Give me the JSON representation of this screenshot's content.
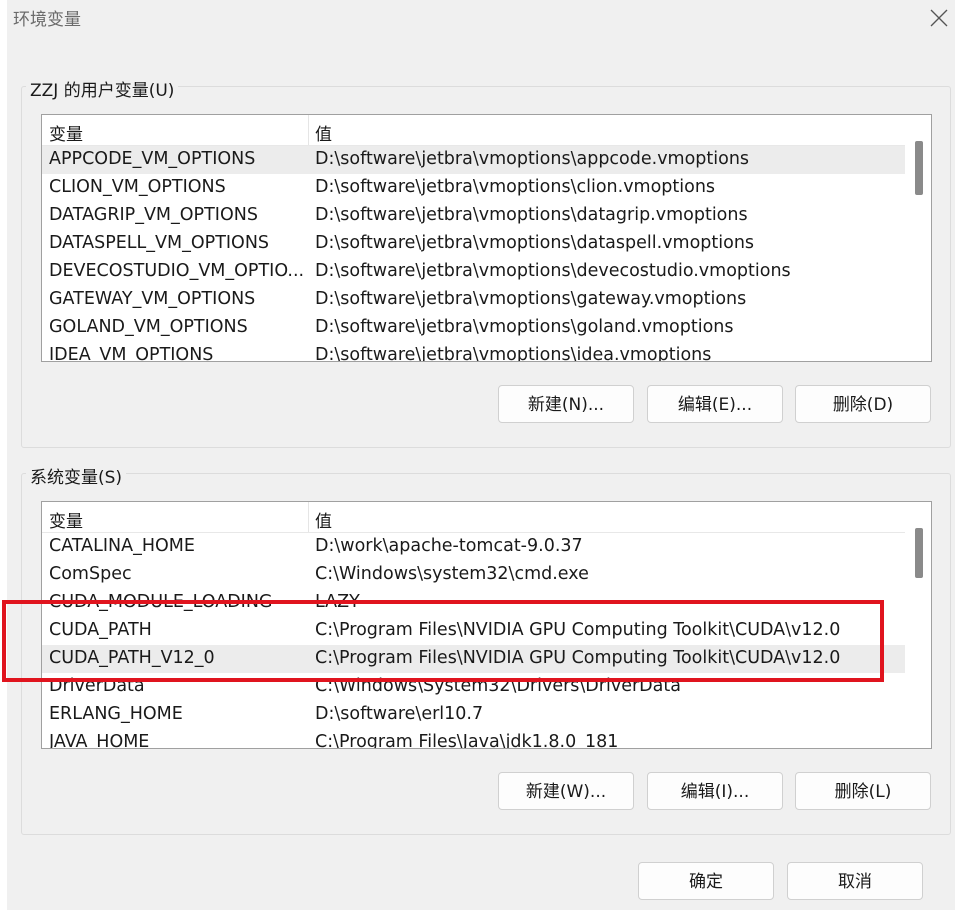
{
  "window": {
    "title": "环境变量"
  },
  "user_vars": {
    "label": "ZZJ 的用户变量(U)",
    "columns": [
      "变量",
      "值"
    ],
    "rows": [
      {
        "name": "APPCODE_VM_OPTIONS",
        "value": "D:\\software\\jetbra\\vmoptions\\appcode.vmoptions"
      },
      {
        "name": "CLION_VM_OPTIONS",
        "value": "D:\\software\\jetbra\\vmoptions\\clion.vmoptions"
      },
      {
        "name": "DATAGRIP_VM_OPTIONS",
        "value": "D:\\software\\jetbra\\vmoptions\\datagrip.vmoptions"
      },
      {
        "name": "DATASPELL_VM_OPTIONS",
        "value": "D:\\software\\jetbra\\vmoptions\\dataspell.vmoptions"
      },
      {
        "name": "DEVECOSTUDIO_VM_OPTIO...",
        "value": "D:\\software\\jetbra\\vmoptions\\devecostudio.vmoptions"
      },
      {
        "name": "GATEWAY_VM_OPTIONS",
        "value": "D:\\software\\jetbra\\vmoptions\\gateway.vmoptions"
      },
      {
        "name": "GOLAND_VM_OPTIONS",
        "value": "D:\\software\\jetbra\\vmoptions\\goland.vmoptions"
      },
      {
        "name": "IDEA_VM_OPTIONS",
        "value": "D:\\software\\jetbra\\vmoptions\\idea.vmoptions"
      }
    ],
    "buttons": {
      "new": "新建(N)...",
      "edit": "编辑(E)...",
      "delete": "删除(D)"
    }
  },
  "system_vars": {
    "label": "系统变量(S)",
    "columns": [
      "变量",
      "值"
    ],
    "rows": [
      {
        "name": "CATALINA_HOME",
        "value": "D:\\work\\apache-tomcat-9.0.37"
      },
      {
        "name": "ComSpec",
        "value": "C:\\Windows\\system32\\cmd.exe"
      },
      {
        "name": "CUDA_MODULE_LOADING",
        "value": "LAZY"
      },
      {
        "name": "CUDA_PATH",
        "value": "C:\\Program Files\\NVIDIA GPU Computing Toolkit\\CUDA\\v12.0"
      },
      {
        "name": "CUDA_PATH_V12_0",
        "value": "C:\\Program Files\\NVIDIA GPU Computing Toolkit\\CUDA\\v12.0"
      },
      {
        "name": "DriverData",
        "value": "C:\\Windows\\System32\\Drivers\\DriverData"
      },
      {
        "name": "ERLANG_HOME",
        "value": "D:\\software\\erl10.7"
      },
      {
        "name": "JAVA_HOME",
        "value": "C:\\Program Files\\Java\\jdk1.8.0_181"
      }
    ],
    "buttons": {
      "new": "新建(W)...",
      "edit": "编辑(I)...",
      "delete": "删除(L)"
    }
  },
  "footer": {
    "ok": "确定",
    "cancel": "取消"
  },
  "colors": {
    "highlight": "#e0141e",
    "selected_row": "#ececec"
  }
}
